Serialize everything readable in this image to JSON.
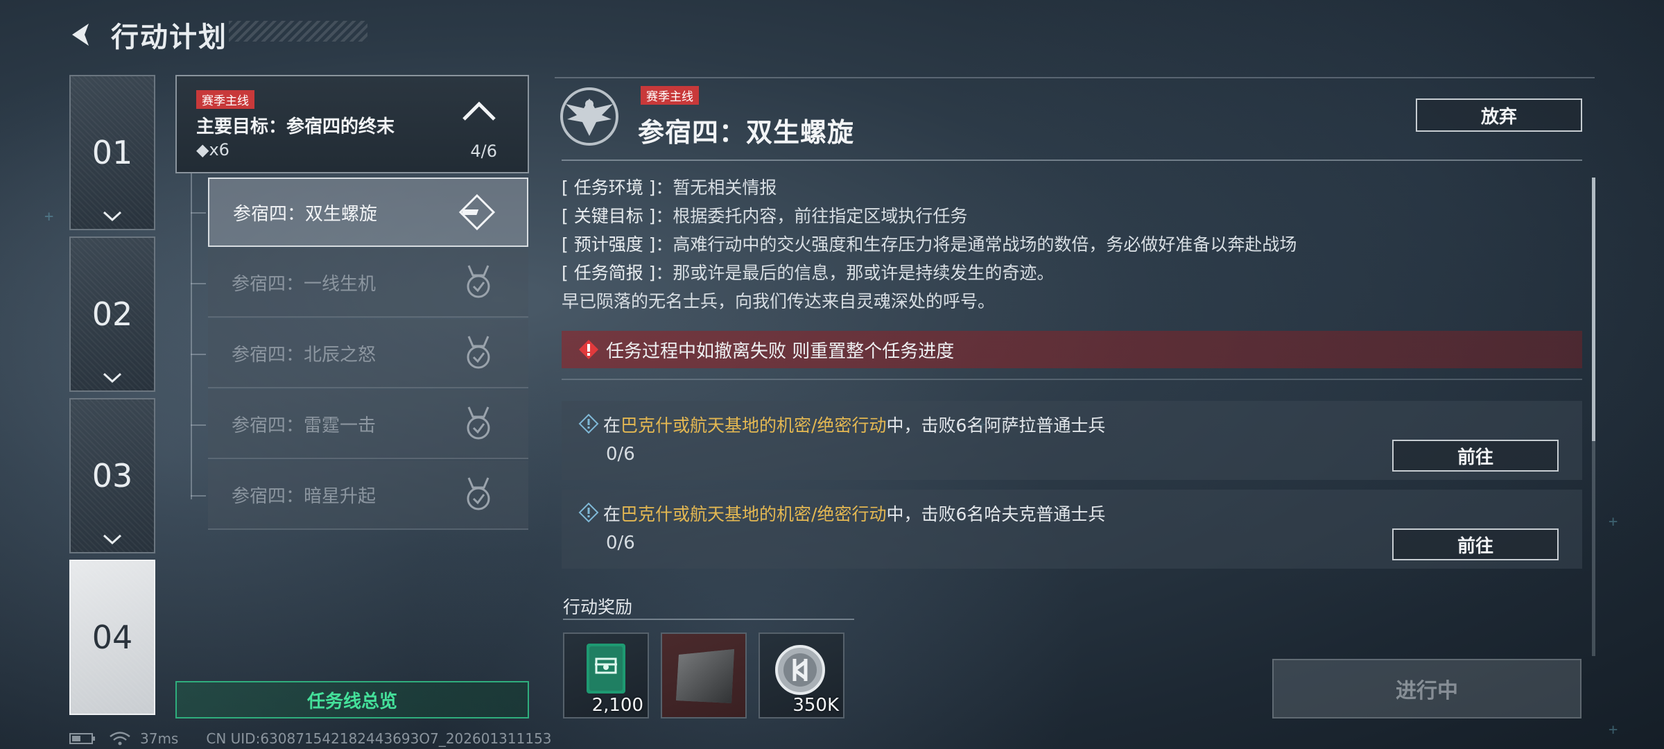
{
  "header": {
    "title": "行动计划"
  },
  "chapters": [
    {
      "num": "01"
    },
    {
      "num": "02"
    },
    {
      "num": "03"
    },
    {
      "num": "04"
    }
  ],
  "goal_card": {
    "tag": "赛季主线",
    "title": "主要目标：参宿四的终末",
    "sub": "◆x6",
    "progress": "4/6"
  },
  "missions": [
    {
      "label": "参宿四：双生螺旋",
      "state": "active"
    },
    {
      "label": "参宿四：一线生机",
      "state": "done"
    },
    {
      "label": "参宿四：北辰之怒",
      "state": "done"
    },
    {
      "label": "参宿四：雷霆一击",
      "state": "done"
    },
    {
      "label": "参宿四：暗星升起",
      "state": "done"
    }
  ],
  "overview_button": "任务线总览",
  "detail": {
    "tag": "赛季主线",
    "title": "参宿四：双生螺旋",
    "abandon": "放弃",
    "info": [
      {
        "key": "[ 任务环境 ]",
        "sep": "：",
        "value": "暂无相关情报"
      },
      {
        "key": "[ 关键目标 ]",
        "sep": "：",
        "value": "根据委托内容，前往指定区域执行任务"
      },
      {
        "key": "[ 预计强度 ]",
        "sep": "：",
        "value": "高难行动中的交火强度和生存压力将是通常战场的数倍，务必做好准备以奔赴战场"
      },
      {
        "key": "[ 任务简报 ]",
        "sep": "：",
        "value": "那或许是最后的信息，那或许是持续发生的奇迹。"
      },
      {
        "key": "",
        "sep": "",
        "value": "早已陨落的无名士兵，向我们传达来自灵魂深处的呼号。"
      }
    ],
    "warning": "任务过程中如撤离失败 则重置整个任务进度",
    "tasks": [
      {
        "pre": "在",
        "highlight": "巴克什或航天基地的机密/绝密行动",
        "post": "中，击败6名阿萨拉普通士兵",
        "count": "0/6",
        "button": "前往"
      },
      {
        "pre": "在",
        "highlight": "巴克什或航天基地的机密/绝密行动",
        "post": "中，击败6名哈夫克普通士兵",
        "count": "0/6",
        "button": "前往"
      }
    ]
  },
  "rewards": {
    "title": "行动奖励",
    "items": [
      {
        "icon": "supply-card-icon",
        "count": "2,100"
      },
      {
        "icon": "material-plate-icon",
        "count": ""
      },
      {
        "icon": "coin-icon",
        "count": "350K"
      }
    ]
  },
  "progress_button": "进行中",
  "statusbar": {
    "ping": "37ms",
    "uid": "CN UID:630871542182443693O7_202601311153"
  },
  "colors": {
    "accent_red": "#c8393a",
    "highlight_yellow": "#e4b852",
    "overview_green": "#44e09a"
  }
}
